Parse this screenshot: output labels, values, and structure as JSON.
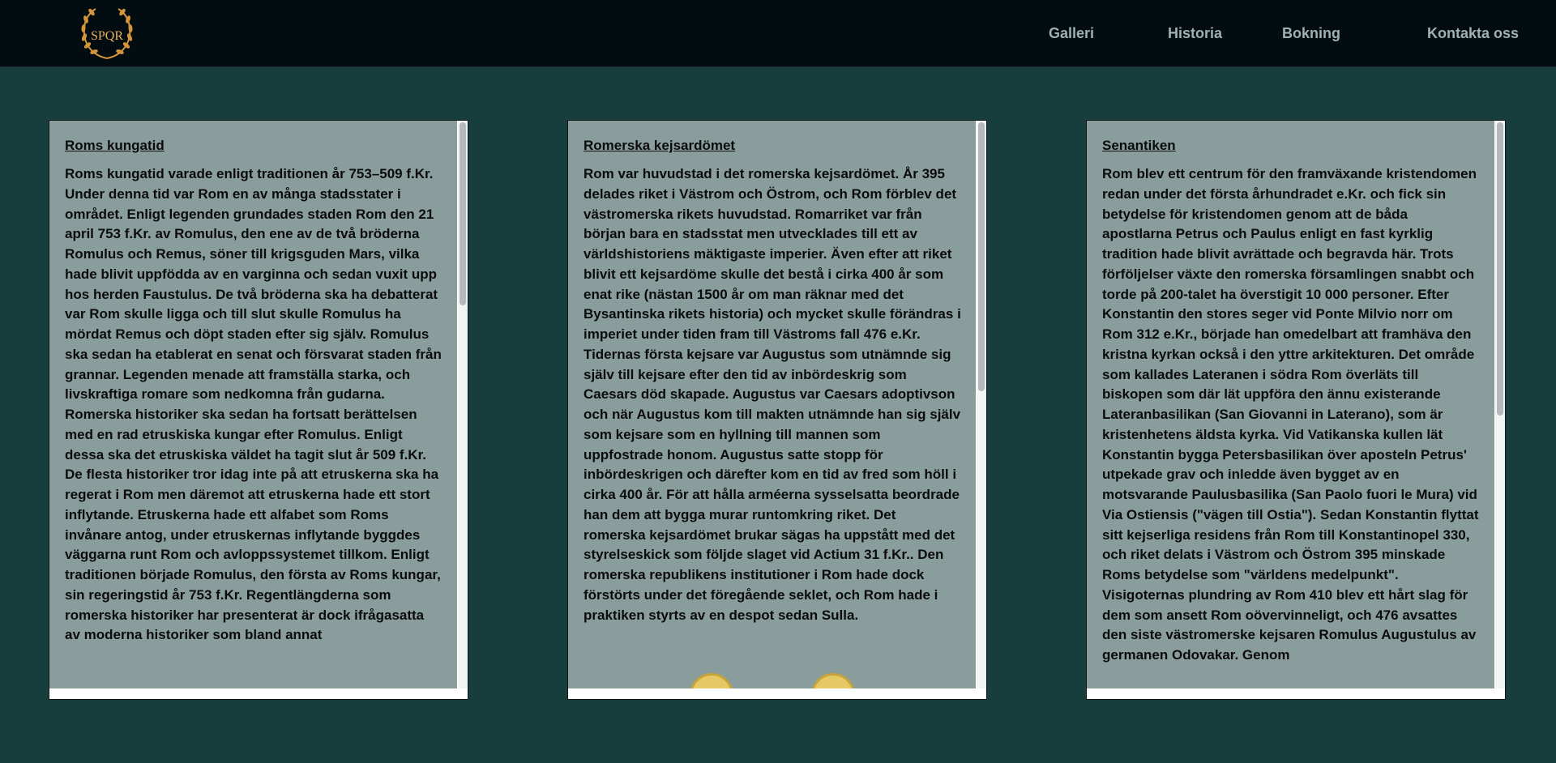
{
  "header": {
    "logo_text": "SPQR",
    "nav": [
      "Galleri",
      "Historia",
      "Bokning",
      "Kontakta oss"
    ]
  },
  "colors": {
    "page_background": "#173d3d",
    "header_background": "#030c11",
    "card_background": "#8a9d9d",
    "nav_text": "#9fb2b2",
    "logo_gold": "#d4943a"
  },
  "cards": [
    {
      "title": "Roms kungatid",
      "text": "Roms kungatid varade enligt traditionen år 753–509 f.Kr. Under denna tid var Rom en av många stadsstater i området. Enligt legenden grundades staden Rom den 21 april 753 f.Kr. av Romulus, den ene av de två bröderna Romulus och Remus, söner till krigsguden Mars, vilka hade blivit uppfödda av en varginna och sedan vuxit upp hos herden Faustulus. De två bröderna ska ha debatterat var Rom skulle ligga och till slut skulle Romulus ha mördat Remus och döpt staden efter sig själv. Romulus ska sedan ha etablerat en senat och försvarat staden från grannar. Legenden menade att framställa starka, och livskraftiga romare som nedkomna från gudarna. Romerska historiker ska sedan ha fortsatt berättelsen med en rad etruskiska kungar efter Romulus. Enligt dessa ska det etruskiska väldet ha tagit slut år 509 f.Kr. De flesta historiker tror idag inte på att etruskerna ska ha regerat i Rom men däremot att etruskerna hade ett stort inflytande. Etruskerna hade ett alfabet som Roms invånare antog, under etruskernas inflytande byggdes väggarna runt Rom och avloppssystemet tillkom. Enligt traditionen började Romulus, den första av Roms kungar, sin regeringstid år 753 f.Kr. Regentlängderna som romerska historiker har presenterat är dock ifrågasatta av moderna historiker som bland annat"
    },
    {
      "title": "Romerska kejsardömet",
      "text": "Rom var huvudstad i det romerska kejsardömet. År 395 delades riket i Västrom och Östrom, och Rom förblev det västromerska rikets huvudstad. Romarriket var från början bara en stadsstat men utvecklades till ett av världshistoriens mäktigaste imperier. Även efter att riket blivit ett kejsardöme skulle det bestå i cirka 400 år som enat rike (nästan 1500 år om man räknar med det Bysantinska rikets historia) och mycket skulle förändras i imperiet under tiden fram till Västroms fall 476 e.Kr. Tidernas första kejsare var Augustus som utnämnde sig själv till kejsare efter den tid av inbördeskrig som Caesars död skapade. Augustus var Caesars adoptivson och när Augustus kom till makten utnämnde han sig själv som kejsare som en hyllning till mannen som uppfostrade honom. Augustus satte stopp för inbördeskrigen och därefter kom en tid av fred som höll i cirka 400 år. För att hålla arméerna sysselsatta beordrade han dem att bygga murar runtomkring riket. Det romerska kejsardömet brukar sägas ha uppstått med det styrelseskick som följde slaget vid Actium 31 f.Kr.. Den romerska republikens institutioner i Rom hade dock förstörts under det föregående seklet, och Rom hade i praktiken styrts av en despot sedan Sulla."
    },
    {
      "title": "Senantiken",
      "text": "Rom blev ett centrum för den framväxande kristendomen redan under det första århundradet e.Kr. och fick sin betydelse för kristendomen genom att de båda apostlarna Petrus och Paulus enligt en fast kyrklig tradition hade blivit avrättade och begravda här. Trots förföljelser växte den romerska församlingen snabbt och torde på 200-talet ha överstigit 10 000 personer. Efter Konstantin den stores seger vid Ponte Milvio norr om Rom 312 e.Kr., började han omedelbart att framhäva den kristna kyrkan också i den yttre arkitekturen. Det område som kallades Lateranen i södra Rom överläts till biskopen som där lät uppföra den ännu existerande Lateranbasilikan (San Giovanni in Laterano), som är kristenhetens äldsta kyrka. Vid Vatikanska kullen lät Konstantin bygga Petersbasilikan över aposteln Petrus' utpekade grav och inledde även bygget av en motsvarande Paulusbasilika (San Paolo fuori le Mura) vid Via Ostiensis (\"vägen till Ostia\"). Sedan Konstantin flyttat sitt kejserliga residens från Rom till Konstantinopel 330, och riket delats i Västrom och Östrom 395 minskade Roms betydelse som \"världens medelpunkt\". Visigoternas plundring av Rom 410 blev ett hårt slag för dem som ansett Rom oövervinneligt, och 476 avsattes den siste västromerske kejsaren Romulus Augustulus av germanen Odovakar. Genom"
    }
  ]
}
